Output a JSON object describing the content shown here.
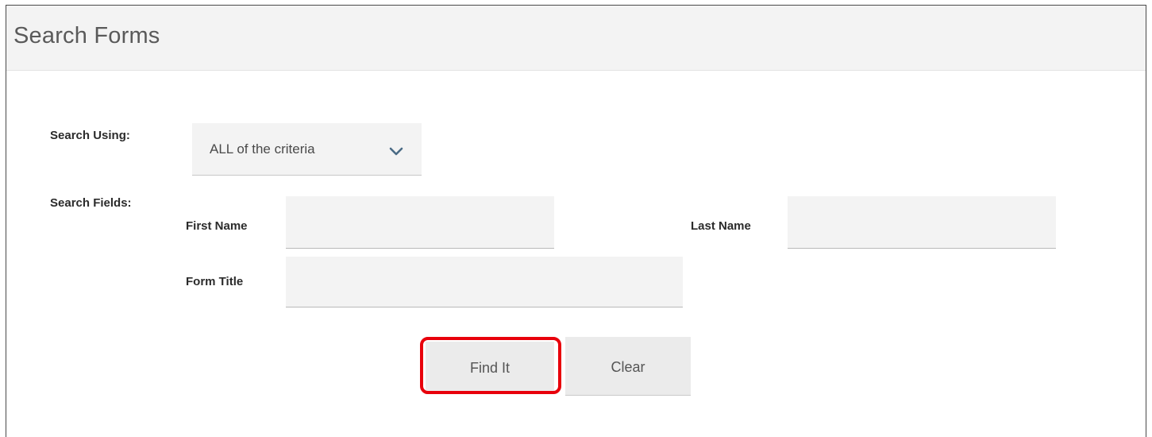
{
  "panel": {
    "title": "Search Forms"
  },
  "search_using": {
    "label": "Search Using:",
    "selected": "ALL of the criteria"
  },
  "search_fields": {
    "label": "Search Fields:",
    "first_name_label": "First Name",
    "first_name_value": "",
    "last_name_label": "Last Name",
    "last_name_value": "",
    "form_title_label": "Form Title",
    "form_title_value": ""
  },
  "buttons": {
    "find_label": "Find It",
    "clear_label": "Clear"
  },
  "colors": {
    "header_bg": "#f3f3f3",
    "input_bg": "#f3f3f3",
    "button_bg": "#ebebeb",
    "highlight": "#e8000b",
    "chevron": "#4a6b85"
  },
  "icons": {
    "select_arrow": "chevron-down-icon"
  }
}
